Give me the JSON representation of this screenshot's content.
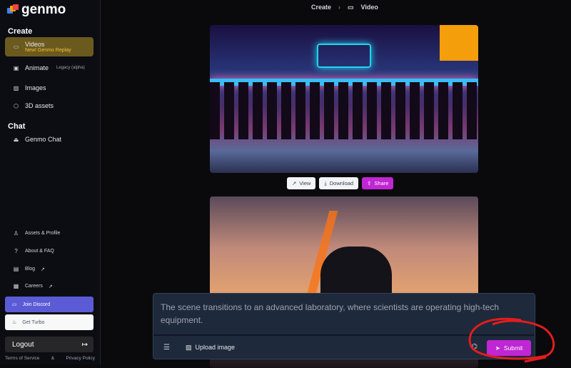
{
  "brand": {
    "name": "genmo"
  },
  "sidebar": {
    "create_heading": "Create",
    "items": [
      {
        "label": "Videos",
        "sublabel": "New! Genmo Replay",
        "icon": "video-camera-icon",
        "active": true
      },
      {
        "label": "Animate",
        "sublabel": "Legacy (alpha)",
        "icon": "gif-icon"
      },
      {
        "label": "Images",
        "icon": "image-icon"
      },
      {
        "label": "3D assets",
        "icon": "cube-icon"
      }
    ],
    "chat_heading": "Chat",
    "chat_items": [
      {
        "label": "Genmo Chat",
        "icon": "bot-icon"
      }
    ],
    "bottom_items": [
      {
        "label": "Assets & Profile",
        "icon": "user-icon"
      },
      {
        "label": "About & FAQ",
        "icon": "question-icon"
      },
      {
        "label": "Blog",
        "icon": "newspaper-icon",
        "external": true
      },
      {
        "label": "Careers",
        "icon": "briefcase-icon",
        "external": true
      }
    ],
    "join_discord": "Join Discord",
    "get_turbo": "Get Turbo",
    "logout": "Logout",
    "terms": "Terms of Service",
    "separator": "&",
    "privacy": "Privacy Policy"
  },
  "breadcrumb": {
    "items": [
      "Create",
      "Video"
    ],
    "separator": "›"
  },
  "actions": {
    "view": "View",
    "download": "Download",
    "share": "Share"
  },
  "prompt": {
    "value": "The scene transitions to an advanced laboratory, where scientists are operating high-tech equipment.",
    "upload": "Upload image",
    "submit": "Submit"
  },
  "colors": {
    "accent": "#c026d3",
    "active_nav": "#6b5a1e",
    "discord": "#5865f2",
    "annotation": "#e11d1d"
  }
}
